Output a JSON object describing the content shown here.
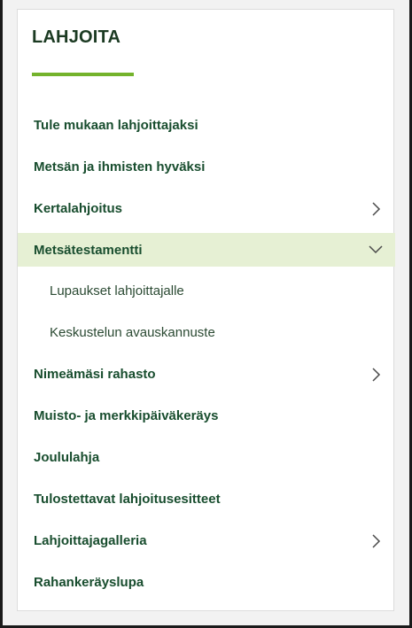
{
  "sidebar": {
    "title": "LAHJOITA",
    "items": [
      {
        "label": "Tule mukaan lahjoittajaksi"
      },
      {
        "label": "Metsän ja ihmisten hyväksi"
      },
      {
        "label": "Kertalahjoitus"
      },
      {
        "label": "Metsätestamentti"
      },
      {
        "label": "Lupaukset lahjoittajalle"
      },
      {
        "label": "Keskustelun avauskannuste"
      },
      {
        "label": "Nimeämäsi rahasto"
      },
      {
        "label": "Muisto- ja merkkipäiväkeräys"
      },
      {
        "label": "Joululahja"
      },
      {
        "label": "Tulostettavat lahjoitusesitteet"
      },
      {
        "label": "Lahjoittajagalleria"
      },
      {
        "label": "Rahankeräyslupa"
      }
    ]
  },
  "colors": {
    "accent": "#74b32c",
    "heading": "#1b3a22",
    "link": "#184d2e",
    "active_bg": "#e6f0d4"
  }
}
